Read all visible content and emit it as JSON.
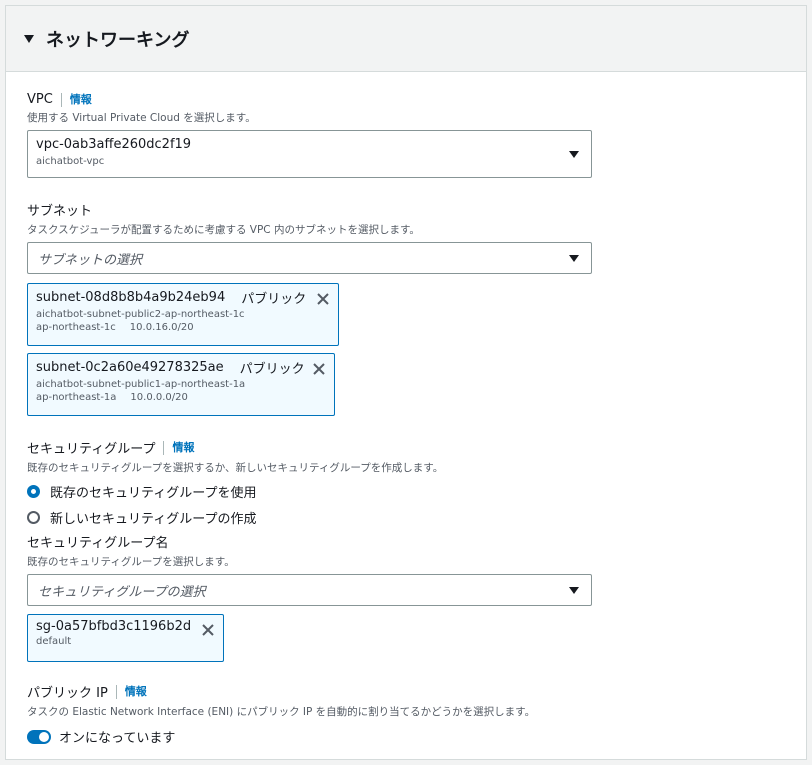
{
  "section": {
    "title": "ネットワーキング"
  },
  "vpc": {
    "label": "VPC",
    "info": "情報",
    "description": "使用する Virtual Private Cloud を選択します。",
    "selected_id": "vpc-0ab3affe260dc2f19",
    "selected_name": "aichatbot-vpc"
  },
  "subnet": {
    "label": "サブネット",
    "description": "タスクスケジューラが配置するために考慮する VPC 内のサブネットを選択します。",
    "placeholder": "サブネットの選択",
    "tokens": [
      {
        "id": "subnet-08d8b8b4a9b24eb94",
        "type": "パブリック",
        "name": "aichatbot-subnet-public2-ap-northeast-1c",
        "az": "ap-northeast-1c",
        "cidr": "10.0.16.0/20"
      },
      {
        "id": "subnet-0c2a60e49278325ae",
        "type": "パブリック",
        "name": "aichatbot-subnet-public1-ap-northeast-1a",
        "az": "ap-northeast-1a",
        "cidr": "10.0.0.0/20"
      }
    ]
  },
  "security_group": {
    "label": "セキュリティグループ",
    "info": "情報",
    "description": "既存のセキュリティグループを選択するか、新しいセキュリティグループを作成します。",
    "option_existing": "既存のセキュリティグループを使用",
    "option_new": "新しいセキュリティグループの作成",
    "name_label": "セキュリティグループ名",
    "name_description": "既存のセキュリティグループを選択します。",
    "placeholder": "セキュリティグループの選択",
    "token": {
      "id": "sg-0a57bfbd3c1196b2d",
      "name": "default"
    }
  },
  "public_ip": {
    "label": "パブリック IP",
    "info": "情報",
    "description": "タスクの Elastic Network Interface (ENI) にパブリック IP を自動的に割り当てるかどうかを選択します。",
    "toggle_label": "オンになっています",
    "enabled": true
  },
  "colors": {
    "accent": "#0073bb",
    "border": "#879596"
  }
}
